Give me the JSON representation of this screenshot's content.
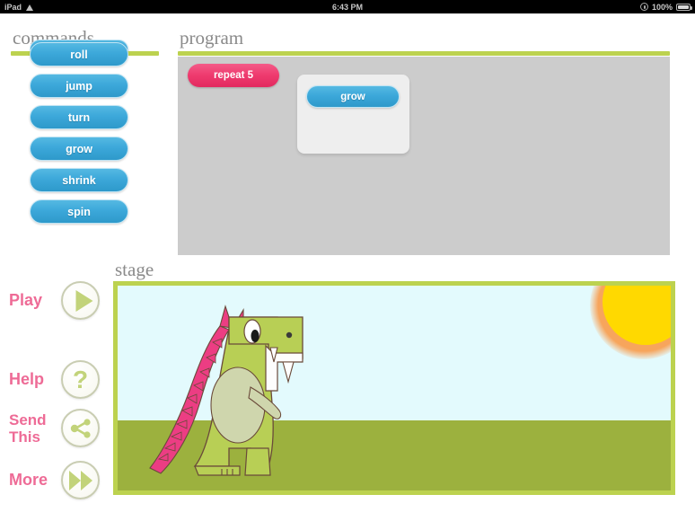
{
  "statusbar": {
    "device": "iPad",
    "wifi_icon": "wifi-icon",
    "time": "6:43 PM",
    "lock_icon": "rotation-lock-icon",
    "battery_percent": "100%",
    "battery_icon": "battery-icon"
  },
  "commands": {
    "title": "commands",
    "clipped_item": {
      "label": ""
    },
    "items": [
      {
        "label": "roll"
      },
      {
        "label": "jump"
      },
      {
        "label": "turn"
      },
      {
        "label": "grow"
      },
      {
        "label": "shrink"
      },
      {
        "label": "spin"
      }
    ]
  },
  "program": {
    "title": "program",
    "blocks": [
      {
        "type": "repeat",
        "label": "repeat 5",
        "count": 5,
        "color": "#ee3a6e"
      }
    ],
    "nested": [
      {
        "type": "command",
        "label": "grow",
        "color": "#3ca8da"
      }
    ],
    "canvas_color": "#cccccc"
  },
  "actions": [
    {
      "label": "Play",
      "icon": "play-icon"
    },
    {
      "label": "Help",
      "icon": "question-mark-icon"
    },
    {
      "label": "Send\nThis",
      "line1": "Send",
      "line2": "This",
      "icon": "share-icon"
    },
    {
      "label": "More",
      "icon": "fast-forward-icon"
    }
  ],
  "stage": {
    "title": "stage",
    "sky_color": "#e3fafd",
    "ground_color": "#9cb13e",
    "frame_color": "#bcd24f",
    "sun_color": "#ffd900",
    "sprite": "dinosaur-sprite"
  },
  "theme": {
    "accent_green": "#bcd24f",
    "accent_pink": "#ee6b96",
    "block_blue": "#3ca8da",
    "block_pink": "#ee3a6e",
    "heading_gray": "#8a8a8a"
  }
}
